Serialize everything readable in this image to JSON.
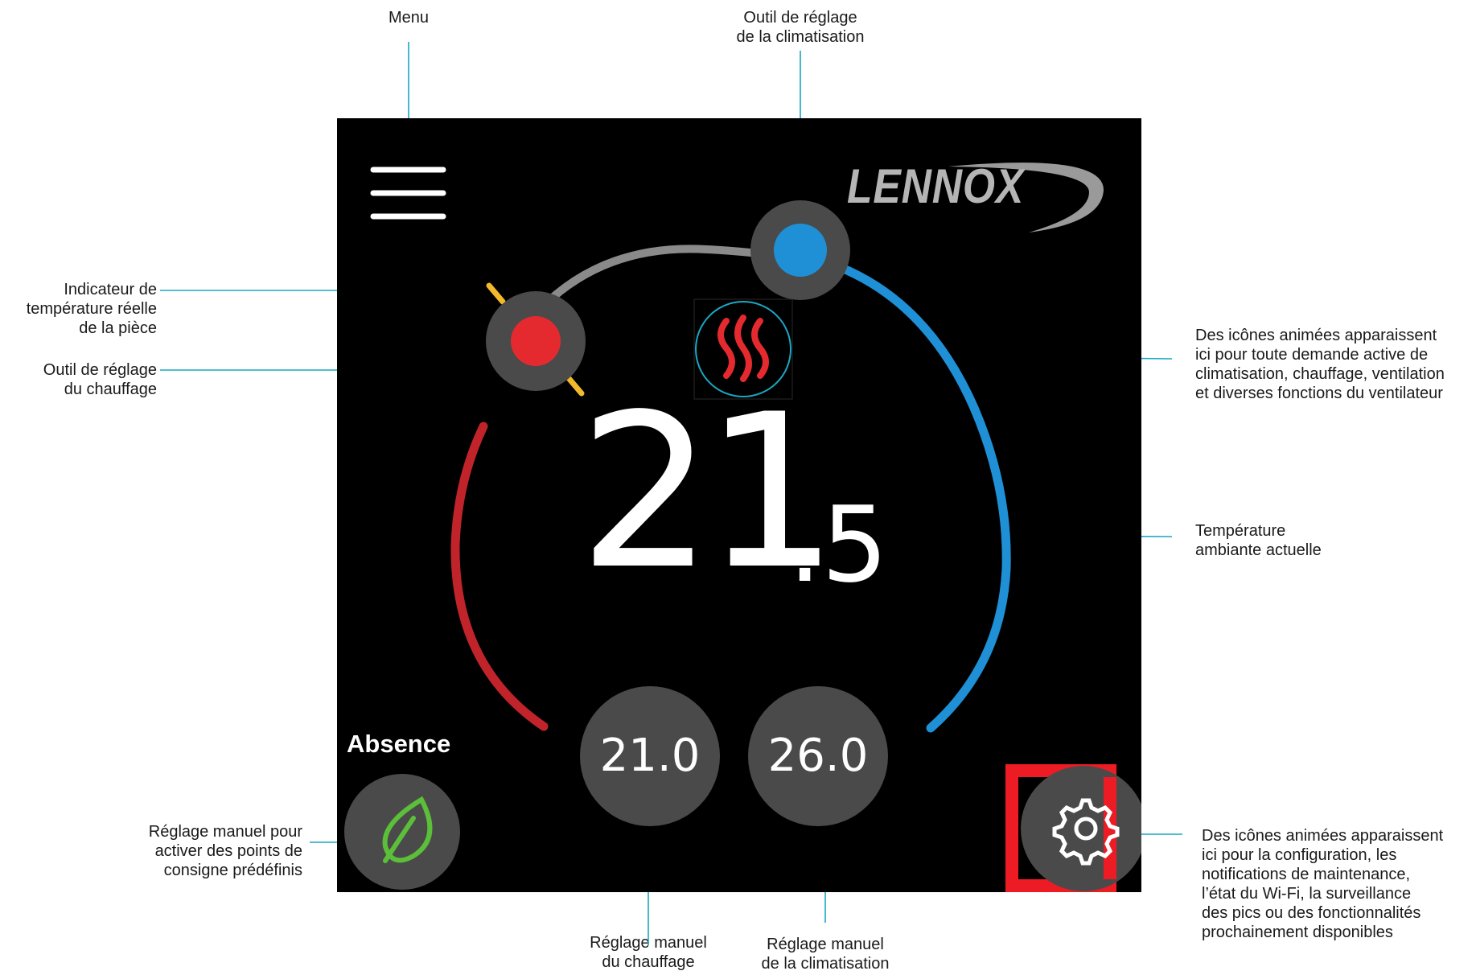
{
  "device": {
    "brand": "LENNOX",
    "temperature": {
      "whole": "21",
      "fraction": ".5"
    },
    "heat_setpoint": "21.0",
    "cool_setpoint": "26.0",
    "mode_label": "Absence",
    "colors": {
      "heat": "#e52a2f",
      "cool": "#1f90d6",
      "room_indicator": "#f2b92a",
      "highlight": "#ed1c24",
      "callout_line": "#1aa7c4"
    }
  },
  "annotations": {
    "menu": "Menu",
    "cool_tool": "Outil de réglage\nde la climatisation",
    "room_indicator": "Indicateur de\ntempérature réelle\nde la pièce",
    "heat_tool": "Outil de réglage\ndu chauffage",
    "active_demand": "Des icônes animées apparaissent\nici pour toute demande active de\nclimatisation, chauffage, ventilation\net diverses fonctions du ventilateur",
    "ambient_temp": "Température\nambiante actuelle",
    "preset": "Réglage manuel pour\nactiver des points de\nconsigne prédéfinis",
    "manual_heat": "Réglage manuel\ndu chauffage",
    "manual_cool": "Réglage manuel\nde la climatisation",
    "settings": "Des icônes animées apparaissent\nici pour la configuration, les\nnotifications de maintenance,\nl’état du Wi-Fi, la surveillance\ndes pics ou des fonctionnalités\nprochainement disponibles"
  }
}
